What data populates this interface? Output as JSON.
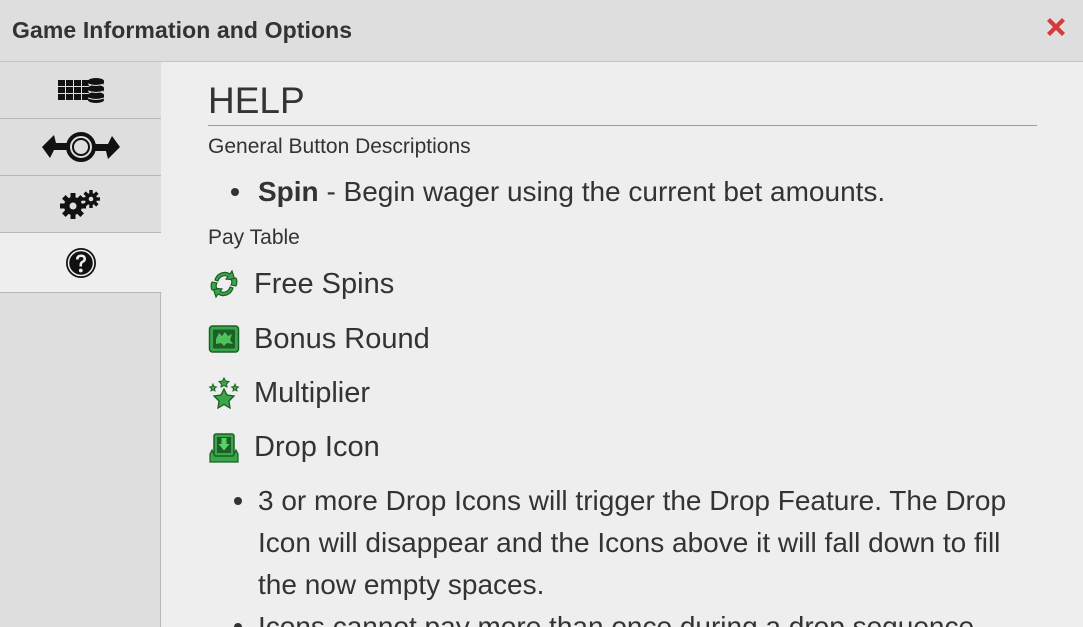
{
  "window": {
    "title": "Game Information and Options",
    "close_icon": "close-icon",
    "accent_close": "#d63b3b"
  },
  "sidebar": {
    "tabs": [
      {
        "name": "paytable-tab",
        "icon": "reels-coins-icon",
        "active": false
      },
      {
        "name": "autoplay-tab",
        "icon": "autoplay-arrows-icon",
        "active": false
      },
      {
        "name": "settings-tab",
        "icon": "gears-icon",
        "active": false
      },
      {
        "name": "help-tab",
        "icon": "question-icon",
        "active": true
      }
    ]
  },
  "help": {
    "title": "HELP",
    "general_heading": "General Button Descriptions",
    "spin_label": "Spin",
    "spin_desc": " - Begin wager using the current bet amounts.",
    "paytable_heading": "Pay Table",
    "pay_items": [
      {
        "label": "Free Spins",
        "icon": "free-spins-icon"
      },
      {
        "label": "Bonus Round",
        "icon": "bonus-round-icon"
      },
      {
        "label": "Multiplier",
        "icon": "multiplier-icon"
      },
      {
        "label": "Drop Icon",
        "icon": "drop-icon"
      }
    ],
    "drop_bullets": [
      "3 or more Drop Icons will trigger the Drop Feature. The Drop Icon will disappear and the Icons above it will fall down to fill the now empty spaces.",
      "Icons cannot pay more than once during a drop sequence."
    ],
    "icon_green": "#3aa64a"
  }
}
